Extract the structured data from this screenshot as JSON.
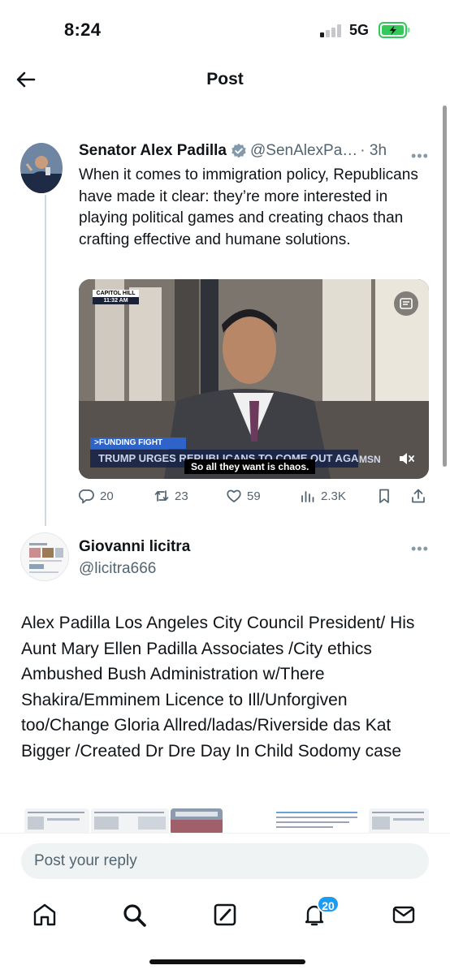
{
  "status_bar": {
    "time": "8:24",
    "network": "5G",
    "signal_bars_active": 1,
    "battery_state": "charging"
  },
  "header": {
    "title": "Post",
    "back_icon": "arrow-left-icon"
  },
  "main_post": {
    "author_name": "Senator Alex Padilla",
    "verified": true,
    "handle": "@SenAlexPa…",
    "time_ago": "· 3h",
    "text": "When it comes to immigration policy, Republicans have made it clear: they’re more interested in playing political games and creating chaos than crafting effective and humane solutions.",
    "media": {
      "location_tag": "CAPITOL HILL",
      "time_tag": "11:32 AM",
      "segment_label": ">FUNDING FIGHT",
      "headline": "TRUMP URGES REPUBLICANS TO COME OUT AGAINST BORDER DEAL",
      "caption": "So all they want is chaos.",
      "network_logo": "MSN",
      "muted": true
    },
    "stats": {
      "replies": "20",
      "reposts": "23",
      "likes": "59",
      "views": "2.3K"
    }
  },
  "reply_post": {
    "author_name": "Giovanni licitra",
    "handle": "@licitra666",
    "text": "Alex Padilla  Los Angeles City Council President/ His Aunt Mary Ellen Padilla Associates /City ethics  Ambushed Bush Administration w/There Shakira/Emminem Licence to Ill/Unforgiven too/Change Gloria Allred/ladas/Riverside das Kat Bigger /Created Dr Dre Day In Child Sodomy case"
  },
  "composer": {
    "placeholder": "Post your reply"
  },
  "tab_bar": {
    "items": [
      "home-icon",
      "search-icon",
      "grok-icon",
      "notifications-icon",
      "messages-icon"
    ],
    "notifications_badge": "20"
  },
  "colors": {
    "accent": "#1d9bf0",
    "text_primary": "#0f1419",
    "text_secondary": "#536471",
    "battery_green": "#34c759"
  }
}
